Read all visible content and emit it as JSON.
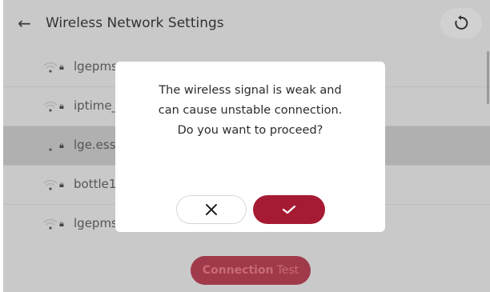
{
  "header": {
    "title": "Wireless Network Settings",
    "back_icon": "arrow-left-icon",
    "refresh_icon": "refresh-icon"
  },
  "networks": [
    {
      "ssid": "lgepms",
      "secured": true,
      "selected": false
    },
    {
      "ssid": "iptime_",
      "secured": true,
      "selected": false
    },
    {
      "ssid": "lge.ess",
      "secured": true,
      "selected": true
    },
    {
      "ssid": "bottle1",
      "secured": true,
      "selected": false
    },
    {
      "ssid": "lgepms",
      "secured": true,
      "selected": false
    }
  ],
  "connection_test": {
    "label_bold": "Connection",
    "label_rest": "Test"
  },
  "dialog": {
    "lines": [
      "The wireless signal is weak and",
      "can cause unstable connection.",
      "Do you want to proceed?"
    ],
    "cancel_icon": "close-icon",
    "confirm_icon": "check-icon"
  },
  "colors": {
    "accent": "#a61a33",
    "overlay": "#c9c9c9"
  }
}
